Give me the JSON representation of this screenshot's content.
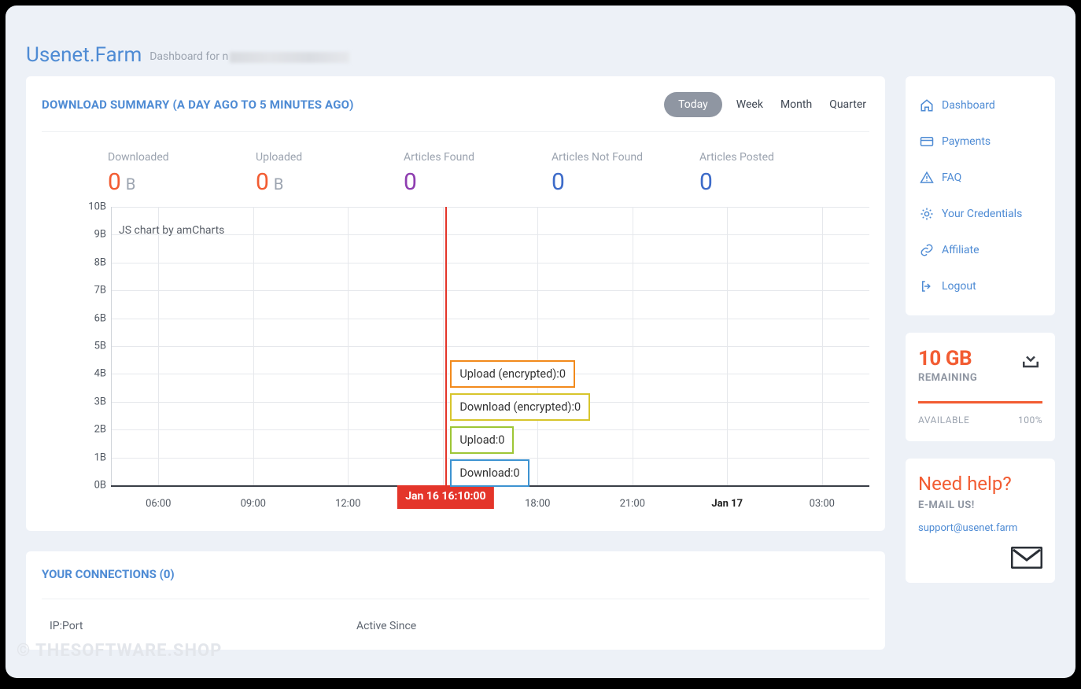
{
  "header": {
    "brand": "Usenet.Farm",
    "subtitle": "Dashboard for n"
  },
  "summary": {
    "title": "DOWNLOAD SUMMARY (A DAY AGO TO 5 MINUTES AGO)",
    "ranges": [
      {
        "label": "Today",
        "active": true
      },
      {
        "label": "Week",
        "active": false
      },
      {
        "label": "Month",
        "active": false
      },
      {
        "label": "Quarter",
        "active": false
      }
    ],
    "stats": [
      {
        "label": "Downloaded",
        "value": "0",
        "unit": "B",
        "color": "c-red"
      },
      {
        "label": "Uploaded",
        "value": "0",
        "unit": "B",
        "color": "c-red"
      },
      {
        "label": "Articles Found",
        "value": "0",
        "unit": "",
        "color": "c-purple"
      },
      {
        "label": "Articles Not Found",
        "value": "0",
        "unit": "",
        "color": "c-blue"
      },
      {
        "label": "Articles Posted",
        "value": "0",
        "unit": "",
        "color": "c-blue"
      }
    ]
  },
  "chart_data": {
    "type": "line",
    "credit": "JS chart by amCharts",
    "ylabel": "",
    "xlabel": "",
    "ylim": [
      0,
      10
    ],
    "yunit": "B",
    "yticks": [
      "0B",
      "1B",
      "2B",
      "3B",
      "4B",
      "5B",
      "6B",
      "7B",
      "8B",
      "9B",
      "10B"
    ],
    "xticks": [
      "06:00",
      "09:00",
      "12:00",
      "",
      "18:00",
      "21:00",
      "Jan 17",
      "03:00"
    ],
    "cursor": {
      "label": "Jan 16 16:10:00"
    },
    "tooltips": [
      {
        "text": "Upload (encrypted):0",
        "class": "tb1"
      },
      {
        "text": "Download (encrypted):0",
        "class": "tb2"
      },
      {
        "text": "Upload:0",
        "class": "tb3"
      },
      {
        "text": "Download:0",
        "class": "tb4"
      }
    ],
    "series": [
      {
        "name": "Upload (encrypted)",
        "values": [
          0,
          0,
          0,
          0,
          0,
          0,
          0,
          0
        ]
      },
      {
        "name": "Download (encrypted)",
        "values": [
          0,
          0,
          0,
          0,
          0,
          0,
          0,
          0
        ]
      },
      {
        "name": "Upload",
        "values": [
          0,
          0,
          0,
          0,
          0,
          0,
          0,
          0
        ]
      },
      {
        "name": "Download",
        "values": [
          0,
          0,
          0,
          0,
          0,
          0,
          0,
          0
        ]
      }
    ]
  },
  "connections": {
    "title": "YOUR CONNECTIONS (0)",
    "cols": [
      "IP:Port",
      "Active Since"
    ]
  },
  "nav": [
    {
      "label": "Dashboard",
      "icon": "home"
    },
    {
      "label": "Payments",
      "icon": "card"
    },
    {
      "label": "FAQ",
      "icon": "alert"
    },
    {
      "label": "Your Credentials",
      "icon": "gear"
    },
    {
      "label": "Affiliate",
      "icon": "link"
    },
    {
      "label": "Logout",
      "icon": "logout"
    }
  ],
  "remaining": {
    "big": "10 GB",
    "sub": "REMAINING",
    "available": "AVAILABLE",
    "pct": "100%"
  },
  "help": {
    "title": "Need help?",
    "sub": "E-MAIL US!",
    "email": "support@usenet.farm"
  },
  "watermark": "© THESOFTWARE.SHOP"
}
